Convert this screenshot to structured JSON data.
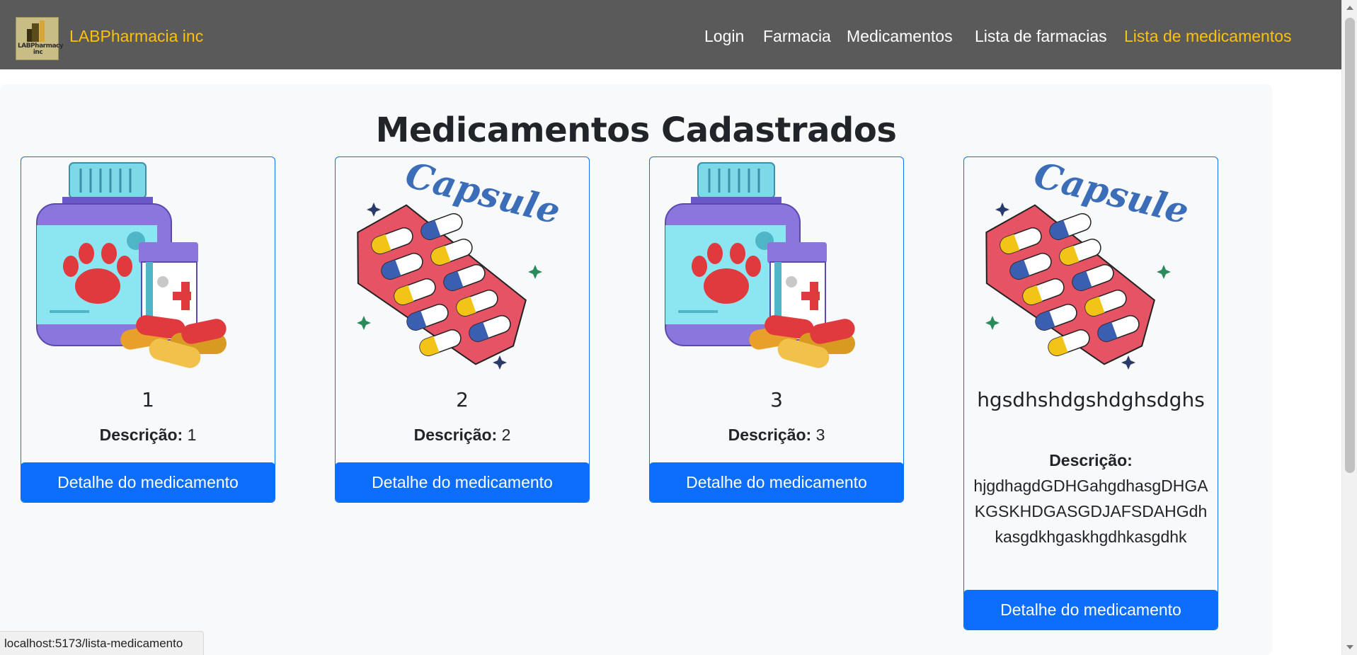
{
  "brand": {
    "name": "LABPharmacia inc",
    "logo_text": "LABPharmacy inc"
  },
  "nav": {
    "items": [
      {
        "label": "Login",
        "active": false
      },
      {
        "label": "Farmacia",
        "active": false
      },
      {
        "label": "Medicamentos",
        "active": false
      },
      {
        "label": "Lista de farmacias",
        "active": false
      },
      {
        "label": "Lista de medicamentos",
        "active": true
      }
    ]
  },
  "colors": {
    "navbar_bg": "#5a5a5a",
    "accent": "#ffc107",
    "primary": "#0d6efd",
    "panel_bg": "#f8f9fa"
  },
  "page": {
    "title": "Medicamentos Cadastrados"
  },
  "medicines": [
    {
      "name": "1",
      "description_label": "Descrição:",
      "description": "1",
      "button": "Detalhe do medicamento",
      "image": "pill-bottle-paw-illustration"
    },
    {
      "name": "2",
      "description_label": "Descrição:",
      "description": "2",
      "button": "Detalhe do medicamento",
      "image": "capsule-blister-illustration",
      "image_text": "Capsule"
    },
    {
      "name": "3",
      "description_label": "Descrição:",
      "description": "3",
      "button": "Detalhe do medicamento",
      "image": "pill-bottle-paw-illustration"
    },
    {
      "name": "hgsdhshdgshdghsdghs",
      "description_label": "Descrição:",
      "description": "hjgdhagdGDHGahgdhasgDHGAKGSKHDGASGDJAFSDAHGdhkasgdkhgaskhgdhkasgdhk",
      "button": "Detalhe do medicamento",
      "image": "capsule-blister-illustration",
      "image_text": "Capsule"
    }
  ],
  "status_bar": {
    "url": "localhost:5173/lista-medicamento"
  }
}
